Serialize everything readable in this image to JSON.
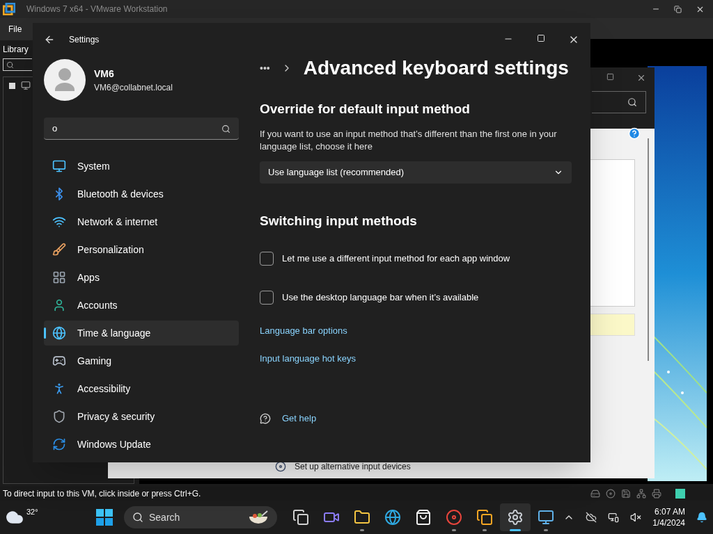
{
  "vmware": {
    "title": "Windows 7 x64 - VMware Workstation",
    "menu": [
      "File"
    ],
    "library_title": "Library",
    "status_text": "To direct input to this VM, click inside or press Ctrl+G.",
    "guest_text": "Set up alternative input devices"
  },
  "settings": {
    "title": "Settings",
    "user": {
      "name": "VM6",
      "email": "VM6@collabnet.local"
    },
    "search": {
      "value": "o"
    },
    "nav": [
      {
        "label": "System",
        "selected": false
      },
      {
        "label": "Bluetooth & devices",
        "selected": false
      },
      {
        "label": "Network & internet",
        "selected": false
      },
      {
        "label": "Personalization",
        "selected": false
      },
      {
        "label": "Apps",
        "selected": false
      },
      {
        "label": "Accounts",
        "selected": false
      },
      {
        "label": "Time & language",
        "selected": true
      },
      {
        "label": "Gaming",
        "selected": false
      },
      {
        "label": "Accessibility",
        "selected": false
      },
      {
        "label": "Privacy & security",
        "selected": false
      },
      {
        "label": "Windows Update",
        "selected": false
      }
    ],
    "breadcrumb": "•••",
    "page_title": "Advanced keyboard settings",
    "content": [
      {
        "kind": "heading",
        "text": "Override for default input method"
      },
      {
        "kind": "paragraph",
        "text": "If you want to use an input method that’s different than the first one in your language list, choose it here"
      },
      {
        "kind": "dropdown",
        "text": "Use language list (recommended)"
      },
      {
        "kind": "heading",
        "text": "Switching input methods"
      },
      {
        "kind": "checkbox",
        "text": "Let me use a different input method for each app window",
        "checked": false
      },
      {
        "kind": "checkbox",
        "text": "Use the desktop language bar when it’s available",
        "checked": false
      },
      {
        "kind": "link",
        "text": "Language bar options"
      },
      {
        "kind": "link",
        "text": "Input language hot keys"
      },
      {
        "kind": "help",
        "text": "Get help"
      }
    ]
  },
  "taskbar": {
    "weather": "32°",
    "search_placeholder": "Search",
    "apps": [
      {
        "running": false,
        "selected": false
      },
      {
        "running": false,
        "selected": false
      },
      {
        "running": true,
        "selected": false
      },
      {
        "running": false,
        "selected": false
      },
      {
        "running": false,
        "selected": false
      },
      {
        "running": true,
        "selected": false
      },
      {
        "running": true,
        "selected": false
      },
      {
        "running": true,
        "selected": true
      },
      {
        "running": true,
        "selected": false
      }
    ],
    "time": "6:07 AM",
    "date": "1/4/2024"
  }
}
